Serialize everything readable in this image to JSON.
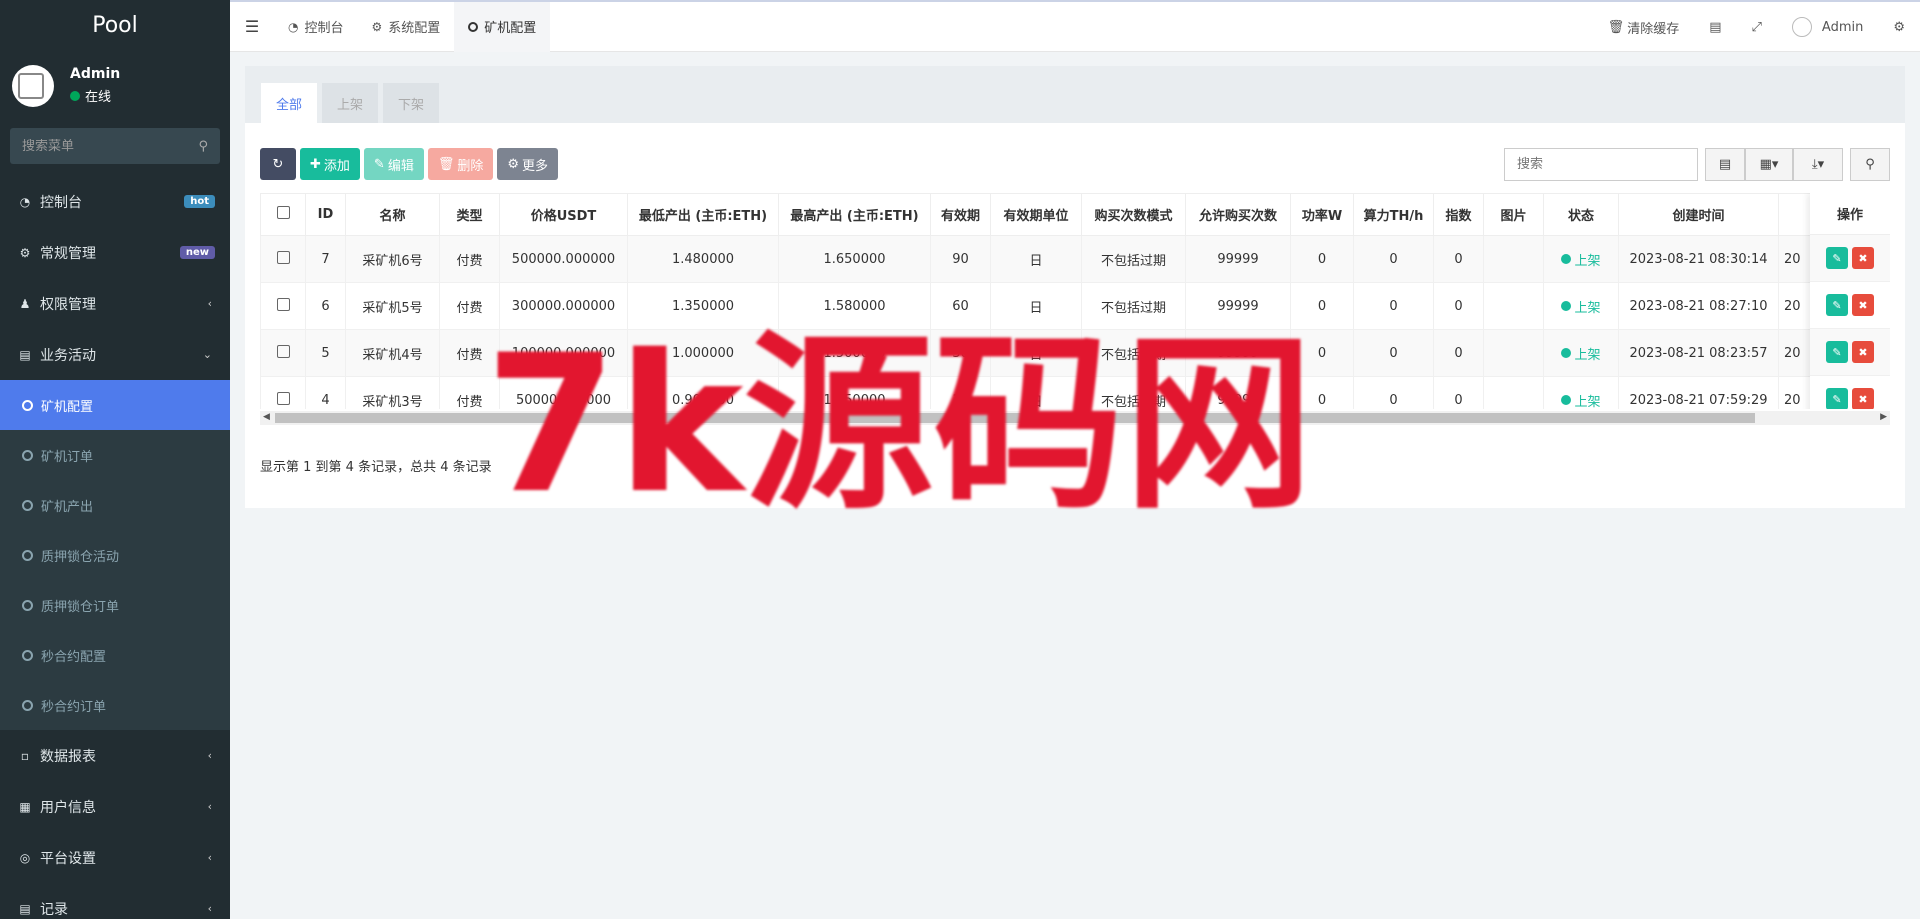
{
  "app": {
    "logo": "Pool"
  },
  "user": {
    "name": "Admin",
    "status": "在线"
  },
  "sidebar": {
    "search_placeholder": "搜索菜单",
    "items": [
      {
        "label": "控制台",
        "icon": "dashboard-icon",
        "badge": "hot"
      },
      {
        "label": "常规管理",
        "icon": "cogs-icon",
        "badge": "new"
      },
      {
        "label": "权限管理",
        "icon": "group-icon"
      },
      {
        "label": "业务活动",
        "icon": "newspaper-icon"
      }
    ],
    "subitems": [
      {
        "label": "矿机配置",
        "active": true
      },
      {
        "label": "矿机订单"
      },
      {
        "label": "矿机产出"
      },
      {
        "label": "质押锁仓活动"
      },
      {
        "label": "质押锁仓订单"
      },
      {
        "label": "秒合约配置"
      },
      {
        "label": "秒合约订单"
      }
    ],
    "bottom_items": [
      {
        "label": "数据报表",
        "icon": "file-icon"
      },
      {
        "label": "用户信息",
        "icon": "user-card-icon"
      },
      {
        "label": "平台设置",
        "icon": "disc-icon"
      },
      {
        "label": "记录",
        "icon": "chart-icon"
      }
    ]
  },
  "topbar": {
    "tabs": [
      "控制台",
      "系统配置",
      "矿机配置"
    ],
    "clear_cache": "清除缓存",
    "admin": "Admin"
  },
  "panel": {
    "tabs": [
      "全部",
      "上架",
      "下架"
    ],
    "toolbar": {
      "add": "添加",
      "edit": "编辑",
      "delete": "删除",
      "more": "更多"
    },
    "search_placeholder": "搜索"
  },
  "table": {
    "headers": [
      "ID",
      "名称",
      "类型",
      "价格USDT",
      "最低产出 (主币:ETH)",
      "最高产出 (主币:ETH)",
      "有效期",
      "有效期单位",
      "购买次数模式",
      "允许购买次数",
      "功率W",
      "算力TH/h",
      "指数",
      "图片",
      "状态",
      "创建时间",
      "",
      "操作"
    ],
    "rows": [
      {
        "id": "7",
        "name": "采矿机6号",
        "type": "付费",
        "price": "500000.000000",
        "min": "1.480000",
        "max": "1.650000",
        "period": "90",
        "unit": "日",
        "mode": "不包括过期",
        "times": "99999",
        "power": "0",
        "hashrate": "0",
        "index": "0",
        "image": "",
        "status": "上架",
        "created": "2023-08-21 08:30:14",
        "extra": "20"
      },
      {
        "id": "6",
        "name": "采矿机5号",
        "type": "付费",
        "price": "300000.000000",
        "min": "1.350000",
        "max": "1.580000",
        "period": "60",
        "unit": "日",
        "mode": "不包括过期",
        "times": "99999",
        "power": "0",
        "hashrate": "0",
        "index": "0",
        "image": "",
        "status": "上架",
        "created": "2023-08-21 08:27:10",
        "extra": "20"
      },
      {
        "id": "5",
        "name": "采矿机4号",
        "type": "付费",
        "price": "100000.000000",
        "min": "1.000000",
        "max": "1.500000",
        "period": "30",
        "unit": "日",
        "mode": "不包括过期",
        "times": "99999",
        "power": "0",
        "hashrate": "0",
        "index": "0",
        "image": "",
        "status": "上架",
        "created": "2023-08-21 08:23:57",
        "extra": "20"
      },
      {
        "id": "4",
        "name": "采矿机3号",
        "type": "付费",
        "price": "50000.000000",
        "min": "0.900000",
        "max": "1.350000",
        "period": "15",
        "unit": "日",
        "mode": "不包括过期",
        "times": "99999",
        "power": "0",
        "hashrate": "0",
        "index": "0",
        "image": "",
        "status": "上架",
        "created": "2023-08-21 07:59:29",
        "extra": "20"
      }
    ]
  },
  "pager_info": "显示第 1 到第 4 条记录，总共 4 条记录",
  "watermark": "7k源码网",
  "colors": {
    "primary": "#4f7bec",
    "success": "#18bc9c",
    "danger": "#e74c3c",
    "sidebar": "#222d32"
  }
}
